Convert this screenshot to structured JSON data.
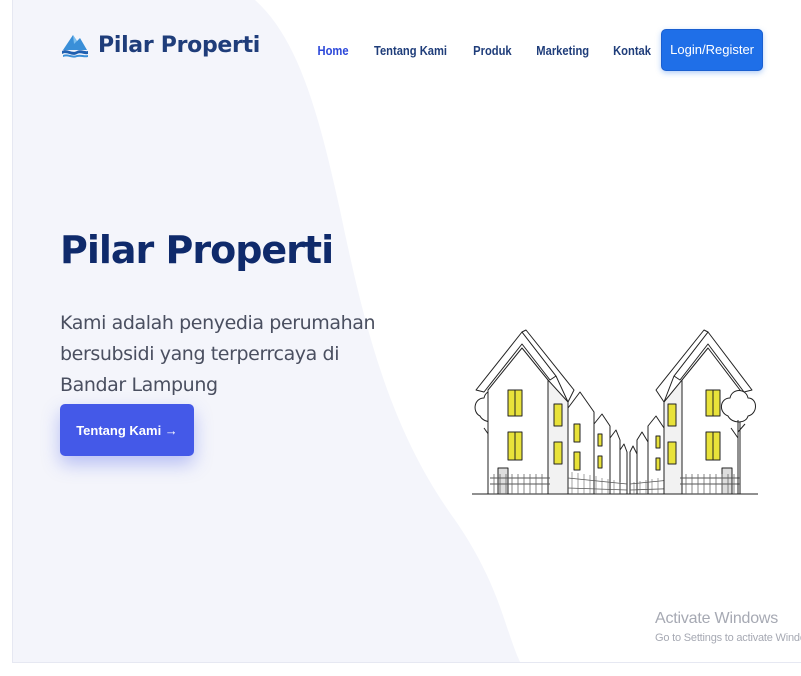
{
  "brand": {
    "name": "Pilar Properti",
    "icon": "mountain-wave-logo-icon"
  },
  "nav": {
    "items": [
      {
        "label": "Home",
        "active": true
      },
      {
        "label": "Tentang Kami",
        "active": false
      },
      {
        "label": "Produk",
        "active": false
      },
      {
        "label": "Marketing",
        "active": false
      },
      {
        "label": "Kontak",
        "active": false
      }
    ],
    "cta_label": "Login/Register"
  },
  "hero": {
    "title": "Pilar Properti",
    "subtitle": "Kami adalah penyedia perumahan bersubsidi yang terperrcaya di Bandar Lampung",
    "button_label": "Tentang Kami →",
    "illustration": "housing-row-illustration"
  },
  "watermark": {
    "title": "Activate Windows",
    "subtitle": "Go to Settings to activate Windows"
  },
  "colors": {
    "brand_dark": "#0f2a6b",
    "nav_text": "#1f3d7a",
    "accent": "#4459e8",
    "cta": "#1f6fe8",
    "background_tint": "#f4f5fb",
    "window_yellow": "#e8e23a"
  }
}
